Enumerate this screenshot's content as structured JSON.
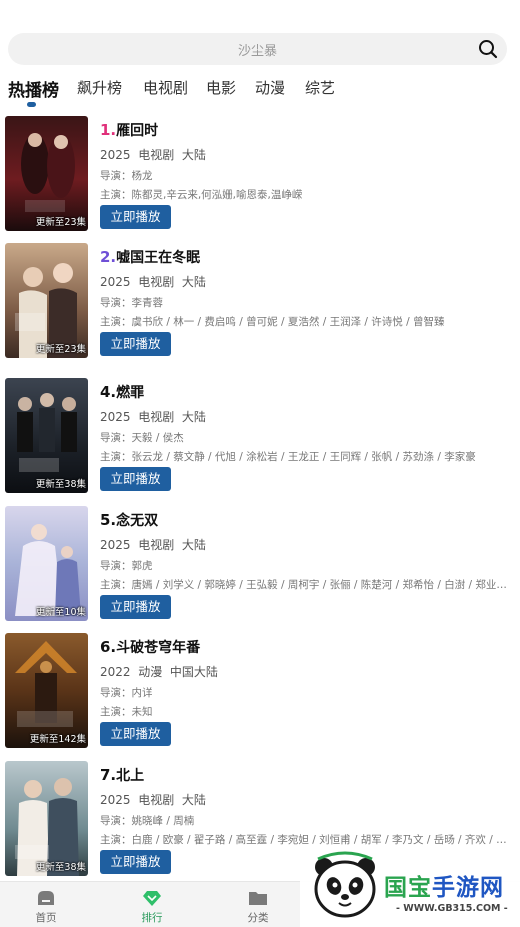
{
  "search": {
    "placeholder": "沙尘暴"
  },
  "tabs": [
    {
      "label": "热播榜",
      "active": true
    },
    {
      "label": "飙升榜"
    },
    {
      "label": "电视剧"
    },
    {
      "label": "电影"
    },
    {
      "label": "动漫"
    },
    {
      "label": "综艺"
    }
  ],
  "colors": {
    "accent": "#1f5fa0",
    "rank_1": "#e0307a",
    "rank_2": "#6f4fd6",
    "nav_active": "#2a9a5c"
  },
  "items": [
    {
      "rank": "1.",
      "title": "雁回时",
      "year": "2025",
      "category": "电视剧",
      "region": "大陆",
      "director": "导演：杨龙",
      "cast": "主演：陈都灵,辛云来,何泓姗,喻恩泰,温峥嵘",
      "badge": "更新至23集",
      "play_label": "立即播放"
    },
    {
      "rank": "2.",
      "title": "嘘国王在冬眠",
      "year": "2025",
      "category": "电视剧",
      "region": "大陆",
      "director": "导演：李青蓉",
      "cast": "主演：虞书欣 / 林一 / 费启鸣 / 曾可妮 / 夏浩然 / 王润泽 / 许诗悦 / 曾智臻",
      "badge": "更新至23集",
      "play_label": "立即播放"
    },
    {
      "rank": "4.",
      "title": "燃罪",
      "year": "2025",
      "category": "电视剧",
      "region": "大陆",
      "director": "导演：天毅 / 侯杰",
      "cast": "主演：张云龙 / 蔡文静 / 代旭 / 涂松岩 / 王龙正 / 王同辉 / 张帆 / 苏劲涤 / 李家豪",
      "badge": "更新至38集",
      "play_label": "立即播放"
    },
    {
      "rank": "5.",
      "title": "念无双",
      "year": "2025",
      "category": "电视剧",
      "region": "大陆",
      "director": "导演：郭虎",
      "cast": "主演：唐嫣 / 刘学义 / 郭晓婷 / 王弘毅 / 周柯宇 / 张俪 / 陈楚河 / 郑希怡 / 白澍 / 郑业成 / …",
      "badge": "更新至10集",
      "play_label": "立即播放"
    },
    {
      "rank": "6.",
      "title": "斗破苍穹年番",
      "year": "2022",
      "category": "动漫",
      "region": "中国大陆",
      "director": "导演：内详",
      "cast": "主演：未知",
      "badge": "更新至142集",
      "play_label": "立即播放"
    },
    {
      "rank": "7.",
      "title": "北上",
      "year": "2025",
      "category": "电视剧",
      "region": "大陆",
      "director": "导演：姚晓峰 / 周楠",
      "cast": "主演：白鹿 / 欧豪 / 翟子路 / 高至霆 / 李宛妲 / 刘恒甫 / 胡军 / 李乃文 / 岳旸 / 齐欢 / 刘威…",
      "badge": "更新至38集",
      "play_label": "立即播放"
    }
  ],
  "bottom_nav": [
    {
      "label": "首页"
    },
    {
      "label": "排行",
      "active": true
    },
    {
      "label": "分类"
    }
  ],
  "watermark": {
    "brand_green": "国宝",
    "brand_blue": "手游网",
    "url": "- WWW.GB315.COM -"
  }
}
